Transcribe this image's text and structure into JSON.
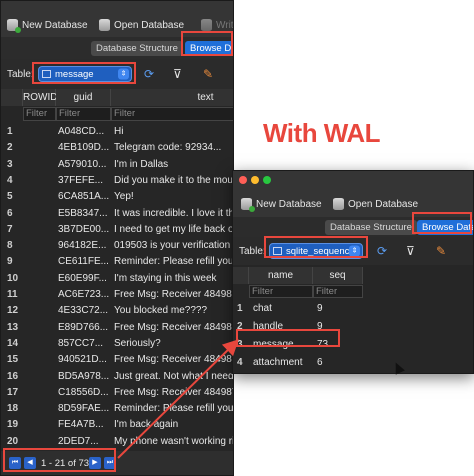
{
  "annotation": "With WAL",
  "main_window": {
    "toolbar": {
      "new_db": "New Database",
      "open_db": "Open Database",
      "write": "Write"
    },
    "tabs": {
      "structure": "Database Structure",
      "browse": "Browse Data"
    },
    "table_label": "Table:",
    "table_select": "message",
    "headers": [
      "ROWID",
      "guid",
      "text"
    ],
    "filter_placeholder": "Filter",
    "rows": [
      [
        "1",
        "A048CD...",
        "Hi"
      ],
      [
        "2",
        "4EB109D...",
        "Telegram code: 92934..."
      ],
      [
        "3",
        "A579010...",
        "I'm in Dallas"
      ],
      [
        "4",
        "37FEFE...",
        "Did you make it to the mountain"
      ],
      [
        "5",
        "6CA851A...",
        "Yep!"
      ],
      [
        "6",
        "E5B8347...",
        "It was incredible. I love it there"
      ],
      [
        "7",
        "3B7DE00...",
        "I need to get my life back on track"
      ],
      [
        "8",
        "964182E...",
        "019503 is your verification code"
      ],
      [
        "9",
        "CE611FE...",
        "Reminder: Please refill your plan"
      ],
      [
        "10",
        "E60E99F...",
        "I'm staying in this week"
      ],
      [
        "11",
        "AC6E723...",
        "Free Msg: Receiver 484987120"
      ],
      [
        "12",
        "4E33C72...",
        "You blocked me????"
      ],
      [
        "13",
        "E89D766...",
        "Free Msg: Receiver 484987120"
      ],
      [
        "14",
        "857CC7...",
        "Seriously?"
      ],
      [
        "15",
        "940521D...",
        "Free Msg: Receiver 484987120"
      ],
      [
        "16",
        "BD5A978...",
        "Just great. Not what I needed"
      ],
      [
        "17",
        "C18556D...",
        "Free Msg: Receiver 484987120"
      ],
      [
        "18",
        "8D59FAE...",
        "Reminder: Please refill your plan"
      ],
      [
        "19",
        "FE4A7B...",
        "I'm back again"
      ],
      [
        "20",
        "2DED7...",
        "My phone wasn't working right"
      ]
    ],
    "nav_text": "1 - 21 of 73"
  },
  "secondary_window": {
    "toolbar": {
      "new_db": "New Database",
      "open_db": "Open Database"
    },
    "tabs": {
      "structure": "Database Structure",
      "browse": "Browse Data"
    },
    "table_label": "Table:",
    "table_select": "sqlite_sequence",
    "headers": [
      "name",
      "seq"
    ],
    "filter_placeholder": "Filter",
    "rows": [
      [
        "1",
        "chat",
        "9"
      ],
      [
        "2",
        "handle",
        "9"
      ],
      [
        "3",
        "message",
        "73"
      ],
      [
        "4",
        "attachment",
        "6"
      ]
    ]
  },
  "colors": {
    "highlight": "#e8473d",
    "accent": "#1f6fd9",
    "background": "#262626"
  }
}
